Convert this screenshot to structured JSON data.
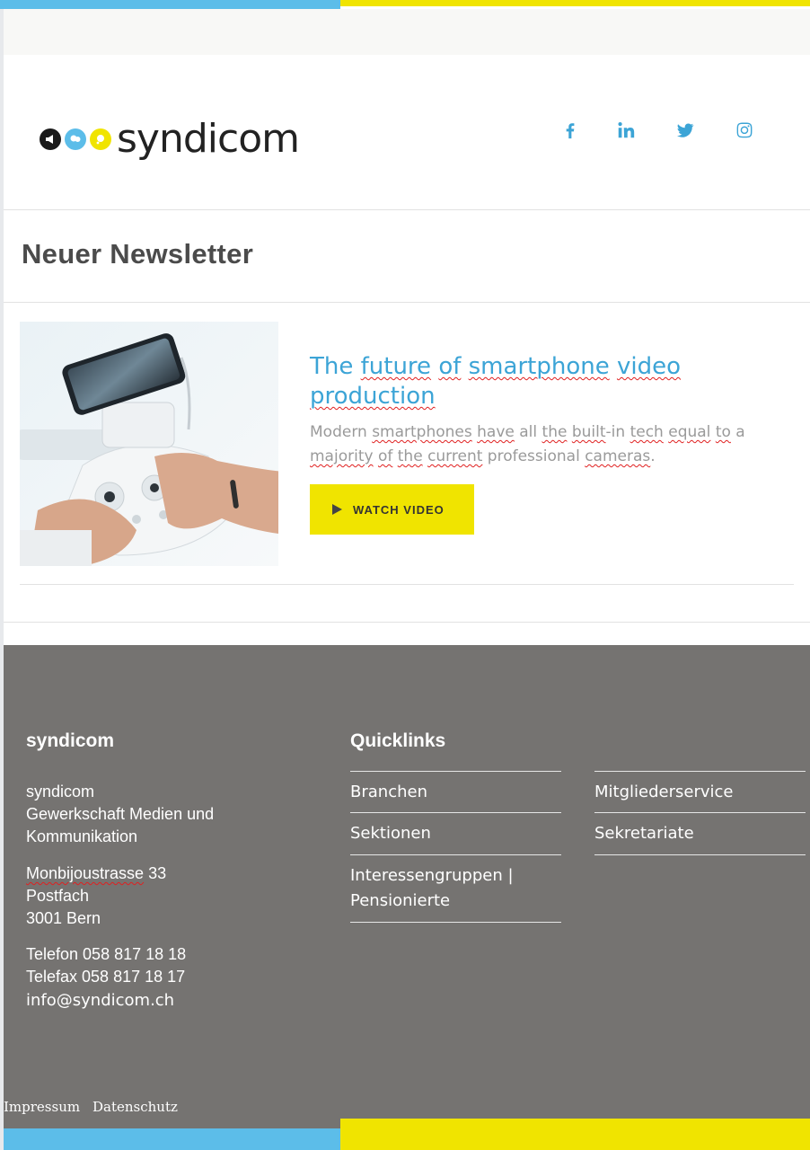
{
  "colors": {
    "accent_blue": "#5cbde9",
    "accent_yellow": "#f0e400",
    "link_blue": "#3ca4d6",
    "footer_gray": "#757371"
  },
  "header": {
    "logo_text": "syndicom",
    "social_icons": [
      "facebook-icon",
      "linkedin-icon",
      "twitter-icon",
      "instagram-icon"
    ]
  },
  "page_title": "Neuer Newsletter",
  "article": {
    "title_parts": [
      "The ",
      "future",
      " ",
      "of",
      " ",
      "smartphone",
      " ",
      "video",
      " ",
      "production"
    ],
    "desc_parts": [
      "Modern ",
      "smartphones",
      " ",
      "have",
      " all ",
      "the",
      " ",
      "built",
      "-in ",
      "tech",
      " ",
      "equal",
      " ",
      "to",
      " a ",
      "majority",
      " ",
      "of",
      " ",
      "the",
      " ",
      "current",
      " professional ",
      "cameras",
      "."
    ],
    "button_label": "WATCH VIDEO"
  },
  "footer": {
    "org_heading": "syndicom",
    "org_name": "syndicom",
    "org_desc_1": "Gewerkschaft Medien und",
    "org_desc_2": "Kommunikation",
    "street": "Monbijoustrasse",
    "street_no": " 33",
    "postfach": "Postfach",
    "city": "3001 Bern",
    "telefon": "Telefon 058 817 18 18",
    "telefax": "Telefax 058 817 18 17",
    "email": "info@syndicom.ch",
    "quicklinks_heading": "Quicklinks",
    "quicklinks_col1": [
      "Branchen",
      "Sektionen",
      "Interessengruppen |",
      "Pensionierte"
    ],
    "quicklinks_col2": [
      "Mitgliederservice",
      "Sekretariate"
    ],
    "impressum": "Impressum",
    "datenschutz": "Datenschutz"
  }
}
